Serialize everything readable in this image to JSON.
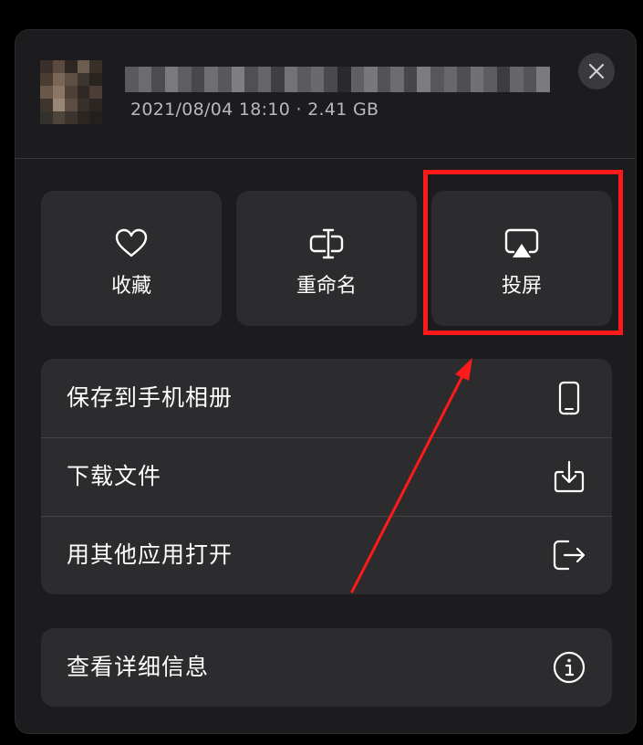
{
  "header": {
    "file_meta": "2021/08/04 18:10 · 2.41 GB",
    "close_icon": "close-icon"
  },
  "actions": [
    {
      "label": "收藏",
      "icon": "heart-icon"
    },
    {
      "label": "重命名",
      "icon": "rename-icon"
    },
    {
      "label": "投屏",
      "icon": "airplay-icon"
    }
  ],
  "menu": {
    "group1": [
      {
        "label": "保存到手机相册",
        "icon": "phone-icon"
      },
      {
        "label": "下载文件",
        "icon": "download-icon"
      },
      {
        "label": "用其他应用打开",
        "icon": "open-external-icon"
      }
    ],
    "group2": [
      {
        "label": "查看详细信息",
        "icon": "info-icon"
      }
    ]
  },
  "annotation": {
    "highlight_color": "#ff1a1a",
    "highlighted_action": "投屏"
  },
  "colors": {
    "background": "#000000",
    "sheet": "#1c1c1e",
    "tile": "#2c2c2e",
    "text": "#ffffff",
    "secondary_text": "#b8b8bd"
  }
}
